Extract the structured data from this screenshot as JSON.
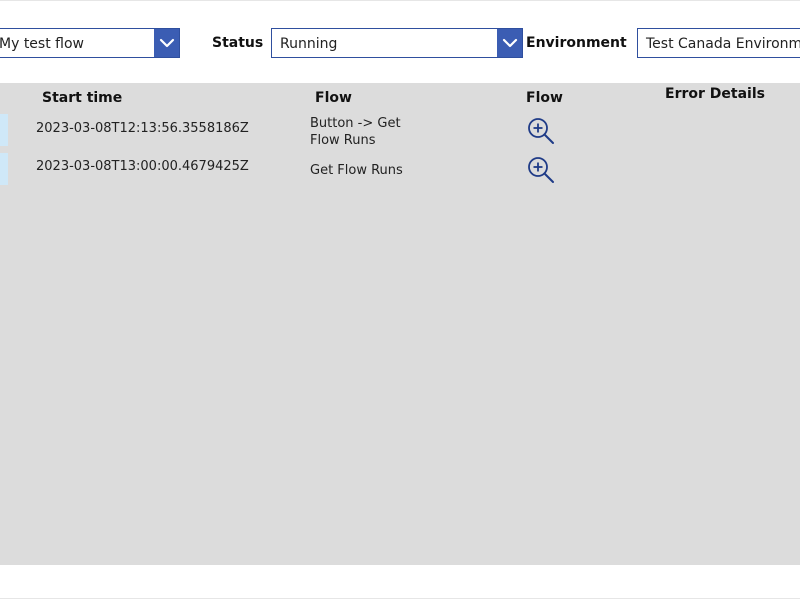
{
  "filters": {
    "flow_value": "My test flow",
    "status_label": "Status",
    "status_value": "Running",
    "environment_label": "Environment",
    "environment_value": "Test Canada Environment"
  },
  "table": {
    "headers": {
      "start_time": "Start time",
      "flow": "Flow",
      "flow_action": "Flow",
      "error_details": "Error Details"
    },
    "rows": [
      {
        "start_time": "2023-03-08T12:13:56.3558186Z",
        "flow": "Button -> Get Flow Runs",
        "flow_line1": "Button -> Get",
        "flow_line2": "Flow Runs",
        "action_icon": "zoom-in-icon"
      },
      {
        "start_time": "2023-03-08T13:00:00.4679425Z",
        "flow": "Get Flow Runs",
        "flow_line1": "Get Flow Runs",
        "flow_line2": "",
        "action_icon": "zoom-in-icon"
      }
    ]
  },
  "colors": {
    "accent": "#3b5db3",
    "border": "#2f4f9e",
    "panel": "#dcdcdc",
    "row_marker": "#cfe8f8",
    "icon": "#1f3b87"
  }
}
